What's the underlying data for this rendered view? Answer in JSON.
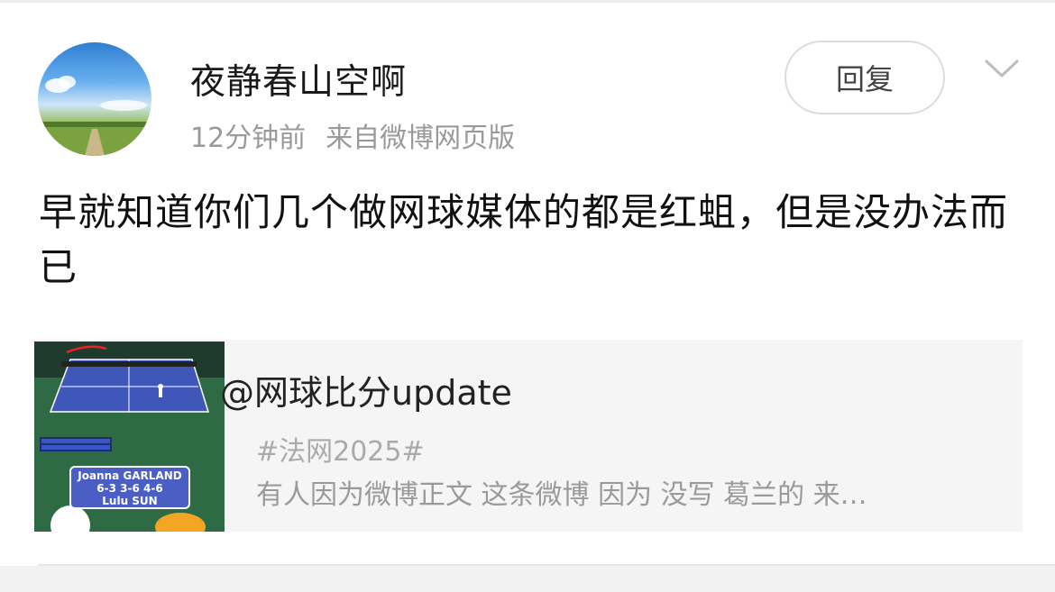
{
  "post": {
    "username": "夜静春山空啊",
    "time": "12分钟前",
    "source": "来自微博网页版",
    "reply_label": "回复",
    "text": "早就知道你们几个做网球媒体的都是红蛆，但是没办法而已"
  },
  "card": {
    "title": "@网球比分update",
    "tag": "#法网2025#",
    "description": "有人因为微博正文 这条微博 因为 没写 葛兰的 来…",
    "thumb_caption_line1": "Joanna GARLAND",
    "thumb_caption_line2": "6-3 3-6 4-6",
    "thumb_caption_line3": "Lulu SUN"
  },
  "colors": {
    "username": "#1a1a1a",
    "meta": "#9a9a9a",
    "card_bg": "#f5f5f5",
    "court_blue": "#4a5ec4"
  },
  "icons": {
    "chevron": "chevron-down-icon"
  }
}
